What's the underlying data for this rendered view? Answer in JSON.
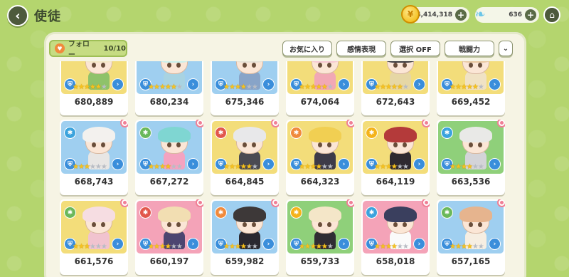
{
  "header": {
    "title": "使徒",
    "back_icon": "chevron-left-icon",
    "home_icon": "home-icon"
  },
  "currency": {
    "gold": "4,414,318",
    "gem": "636"
  },
  "toolbar": {
    "follow_label": "フォロー",
    "follow_count": "10/10",
    "favorite_label": "お気に入り",
    "emote_label": "感情表現",
    "select_label": "選択 OFF",
    "power_label": "戦闘力",
    "more_icon": "double-chevron-down-icon"
  },
  "cards": [
    {
      "power": "680,889",
      "stars": 5,
      "bg": "#f3dd7a",
      "hair": "#f4e7c6",
      "body": "#8fc26a",
      "flower": false
    },
    {
      "power": "680,234",
      "stars": 5,
      "bg": "#9fcff0",
      "hair": "#c9f0ec",
      "body": "#a8d3e2",
      "flower": false
    },
    {
      "power": "675,346",
      "stars": 4,
      "bg": "#9fcff0",
      "hair": "#e6e1d6",
      "body": "#88a4c8",
      "flower": false
    },
    {
      "power": "674,064",
      "stars": 5,
      "bg": "#f3dd7a",
      "hair": "#f6c7d2",
      "body": "#f1a8b5",
      "flower": false
    },
    {
      "power": "672,643",
      "stars": 5,
      "bg": "#f3dd7a",
      "hair": "#3b3a3e",
      "body": "#e6d7a5",
      "flower": false
    },
    {
      "power": "669,452",
      "stars": 5,
      "bg": "#f3dd7a",
      "hair": "#e8c7a0",
      "body": "#f0e2c5",
      "flower": false
    },
    {
      "power": "668,743",
      "stars": 3,
      "bg": "#9fcff0",
      "hair": "#f3f1ee",
      "body": "#e8e6e4",
      "flower": true
    },
    {
      "power": "667,272",
      "stars": 4,
      "bg": "#9fcff0",
      "hair": "#7fd6d2",
      "body": "#f4a3c0",
      "flower": true
    },
    {
      "power": "664,845",
      "stars": 5,
      "bg": "#f3dd7a",
      "hair": "#e8e8ea",
      "body": "#4a4a52",
      "flower": true
    },
    {
      "power": "664,323",
      "stars": 4,
      "bg": "#f3dd7a",
      "hair": "#f1cf52",
      "body": "#3d3b48",
      "flower": true
    },
    {
      "power": "664,119",
      "stars": 4,
      "bg": "#f3dd7a",
      "hair": "#b43a3a",
      "body": "#2f2a30",
      "flower": true
    },
    {
      "power": "663,536",
      "stars": 4,
      "bg": "#8fd07a",
      "hair": "#e9e9e7",
      "body": "#d4d4d8",
      "flower": true
    },
    {
      "power": "661,576",
      "stars": 3,
      "bg": "#f3dd7a",
      "hair": "#f6dde2",
      "body": "#f1c3cf",
      "flower": true
    },
    {
      "power": "660,197",
      "stars": 4,
      "bg": "#f4a3b8",
      "hair": "#f2deb2",
      "body": "#4c4570",
      "flower": true
    },
    {
      "power": "659,982",
      "stars": 4,
      "bg": "#9fcff0",
      "hair": "#3d3838",
      "body": "#2a2830",
      "flower": true
    },
    {
      "power": "659,733",
      "stars": 5,
      "bg": "#8fd07a",
      "hair": "#f4e6c8",
      "body": "#2f2c33",
      "flower": true
    },
    {
      "power": "658,018",
      "stars": 4,
      "bg": "#f4a3b8",
      "hair": "#3a3f5e",
      "body": "#fafafa",
      "flower": true
    },
    {
      "power": "657,165",
      "stars": 4,
      "bg": "#9fcff0",
      "hair": "#e6b48e",
      "body": "#f6eee2",
      "flower": true
    }
  ],
  "colors": {
    "background": "#b4d56e",
    "panel": "#f6f4e4",
    "star_on": "#f6c21e",
    "star_off": "#b8bcc4",
    "accent_green": "#c6dc83"
  }
}
